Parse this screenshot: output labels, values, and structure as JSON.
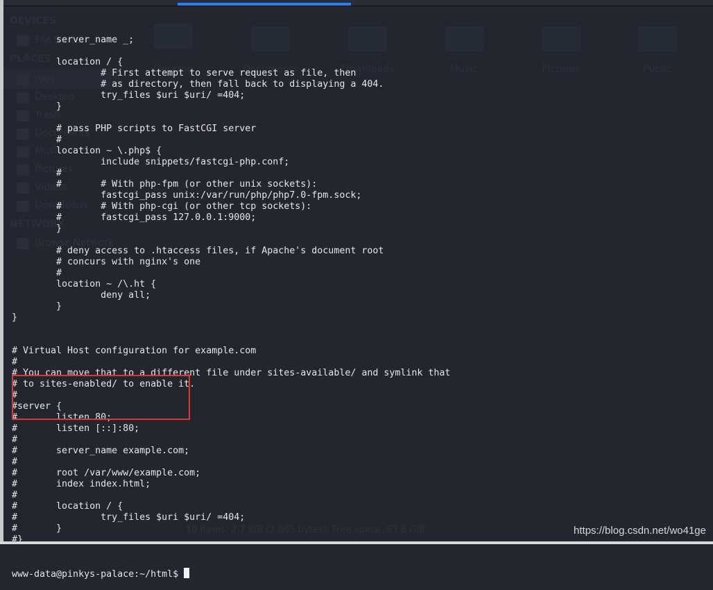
{
  "window": {
    "active_tab_color": "#2d7cf5"
  },
  "background_file_manager": {
    "sidebar": {
      "devices_heading": "DEVICES",
      "devices_items": [
        "File System"
      ],
      "places_heading": "PLACES",
      "places_items": [
        "root",
        "Desktop",
        "Trash",
        "Documents",
        "Music",
        "Pictures",
        "Videos",
        "Downloads"
      ],
      "network_heading": "NETWORK",
      "network_items": [
        "Browse Network"
      ]
    },
    "folders": [
      "Desktop",
      "Documents",
      "Downloads",
      "Music",
      "Pictures",
      "Public"
    ],
    "status": "10 items: 2.7 KiB (2,805 bytes), Free space: 63.8 GiB"
  },
  "terminal": {
    "lines": [
      "        server_name _;",
      "",
      "        location / {",
      "                # First attempt to serve request as file, then",
      "                # as directory, then fall back to displaying a 404.",
      "                try_files $uri $uri/ =404;",
      "        }",
      "",
      "        # pass PHP scripts to FastCGI server",
      "        #",
      "        location ~ \\.php$ {",
      "                include snippets/fastcgi-php.conf;",
      "        #",
      "        #       # With php-fpm (or other unix sockets):",
      "                fastcgi_pass unix:/var/run/php/php7.0-fpm.sock;",
      "        #       # With php-cgi (or other tcp sockets):",
      "        #       fastcgi_pass 127.0.0.1:9000;",
      "        }",
      "",
      "        # deny access to .htaccess files, if Apache's document root",
      "        # concurs with nginx's one",
      "        #",
      "        location ~ /\\.ht {",
      "                deny all;",
      "        }",
      "}",
      "",
      "",
      "# Virtual Host configuration for example.com",
      "#",
      "# You can move that to a different file under sites-available/ and symlink that",
      "# to sites-enabled/ to enable it.",
      "#",
      "#server {",
      "#       listen 80;",
      "#       listen [::]:80;",
      "#",
      "#       server_name example.com;",
      "#",
      "#       root /var/www/example.com;",
      "#       index index.html;",
      "#",
      "#       location / {",
      "#               try_files $uri $uri/ =404;",
      "#       }",
      "#}"
    ],
    "prompt": "www-data@pinkys-palace:~/html$ ",
    "highlight_color": "#e23535"
  },
  "watermark": "https://blog.csdn.net/wo41ge"
}
